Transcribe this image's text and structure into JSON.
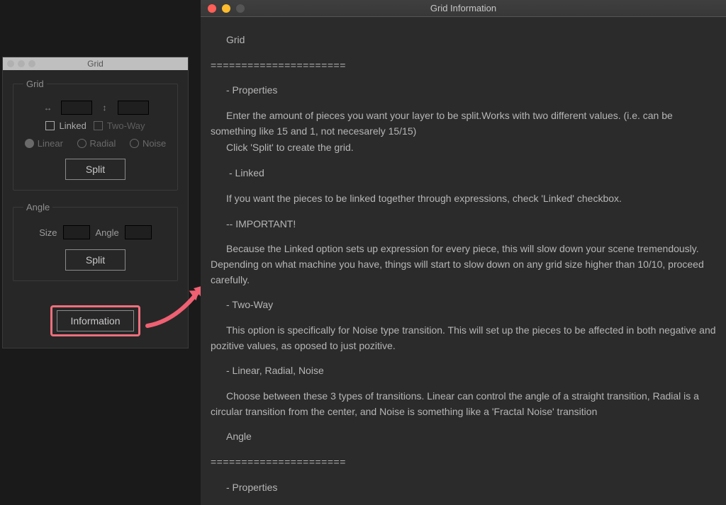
{
  "gridPanel": {
    "title": "Grid",
    "group1": {
      "legend": "Grid",
      "linkedLabel": "Linked",
      "twoWayLabel": "Two-Way",
      "radios": {
        "linear": "Linear",
        "radial": "Radial",
        "noise": "Noise"
      },
      "splitLabel": "Split"
    },
    "group2": {
      "legend": "Angle",
      "sizeLabel": "Size",
      "angleLabel": "Angle",
      "splitLabel": "Split"
    },
    "informationLabel": "Information"
  },
  "infoWindow": {
    "title": "Grid Information",
    "p_grid": "Grid",
    "rule": "======================",
    "p_props": "  - Properties",
    "p_enter_a": "Enter the amount of pieces you want your layer to be split.Works with two different values. (i.e. can be something like 15 and 1, not necesarely 15/15)",
    "p_enter_b": "Click 'Split' to create the grid.",
    "p_linked": "  - Linked",
    "p_linked_body": "If you want the pieces to be linked together through expressions, check 'Linked' checkbox.",
    "p_important": "-- IMPORTANT!",
    "p_important_body": "Because the Linked option sets up expression for every piece, this will slow down your scene tremendously. Depending on what machine you have, things will start to slow down on any grid size higher than 10/10, proceed carefully.",
    "p_twoway": "  - Two-Way",
    "p_twoway_body": "This option is specifically for Noise type transition. This will set up the pieces to be affected in both negative and pozitive values, as oposed to just pozitive.",
    "p_lrn": "  - Linear, Radial, Noise",
    "p_lrn_body": "Choose between these 3 types of transitions. Linear can control the angle of a straight transition, Radial is a circular transition from the center, and Noise is something like a 'Fractal Noise' transition",
    "p_angle": "Angle",
    "p_props2": "  - Properties"
  }
}
